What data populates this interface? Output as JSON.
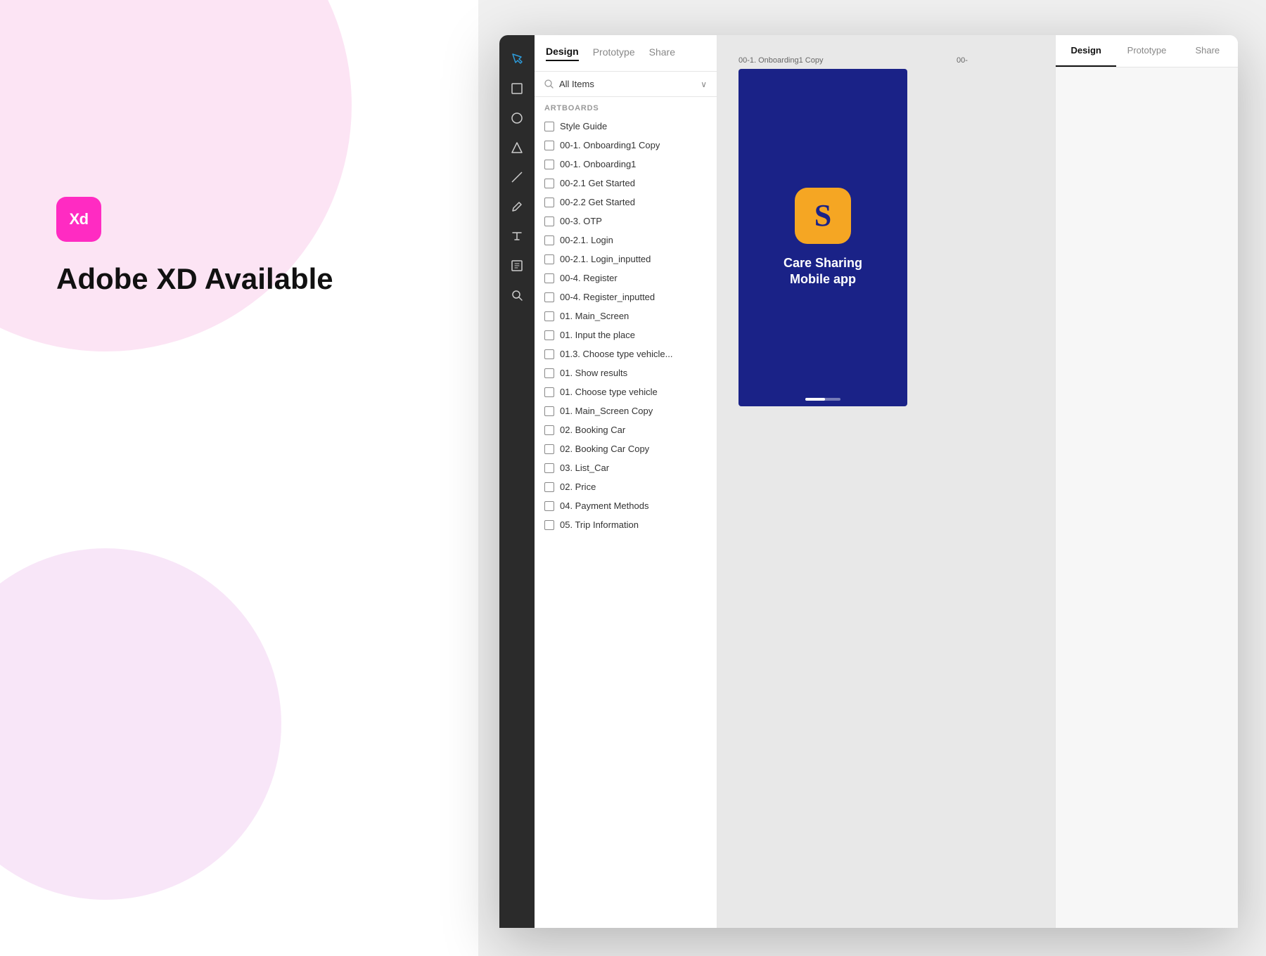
{
  "left": {
    "logo_text": "Xd",
    "title": "Adobe XD Available"
  },
  "xd_app": {
    "tabs": [
      {
        "id": "design",
        "label": "Design",
        "active": true
      },
      {
        "id": "prototype",
        "label": "Prototype",
        "active": false
      },
      {
        "id": "share",
        "label": "Share",
        "active": false
      }
    ],
    "search": {
      "placeholder": "All Items",
      "value": "All Items"
    },
    "section_label": "ARTBOARDS",
    "layers": [
      {
        "id": 1,
        "label": "Style Guide"
      },
      {
        "id": 2,
        "label": "00-1. Onboarding1 Copy"
      },
      {
        "id": 3,
        "label": "00-1. Onboarding1"
      },
      {
        "id": 4,
        "label": "00-2.1 Get Started"
      },
      {
        "id": 5,
        "label": "00-2.2 Get Started"
      },
      {
        "id": 6,
        "label": "00-3. OTP"
      },
      {
        "id": 7,
        "label": "00-2.1. Login"
      },
      {
        "id": 8,
        "label": "00-2.1. Login_inputted"
      },
      {
        "id": 9,
        "label": "00-4. Register"
      },
      {
        "id": 10,
        "label": "00-4. Register_inputted"
      },
      {
        "id": 11,
        "label": "01. Main_Screen"
      },
      {
        "id": 12,
        "label": "01. Input the place"
      },
      {
        "id": 13,
        "label": "01.3. Choose type vehicle..."
      },
      {
        "id": 14,
        "label": "01.  Show results"
      },
      {
        "id": 15,
        "label": "01. Choose type vehicle"
      },
      {
        "id": 16,
        "label": "01. Main_Screen Copy"
      },
      {
        "id": 17,
        "label": "02. Booking Car"
      },
      {
        "id": 18,
        "label": "02. Booking Car Copy"
      },
      {
        "id": 19,
        "label": "03. List_Car"
      },
      {
        "id": 20,
        "label": "02. Price"
      },
      {
        "id": 21,
        "label": "04. Payment Methods"
      },
      {
        "id": 22,
        "label": "05. Trip Information"
      }
    ],
    "artboard_title": "00-1. Onboarding1 Copy",
    "artboard_title_2": "00-",
    "app_icon_letter": "S",
    "app_name_line1": "Care Sharing",
    "app_name_line2": "Mobile app"
  },
  "icons": {
    "cursor": "▶",
    "rect": "□",
    "circle": "○",
    "triangle": "△",
    "line": "/",
    "pen": "✒",
    "text": "T",
    "component": "⊡",
    "zoom": "⌕",
    "search": "⌕",
    "chevron_down": "∨",
    "doc": "□"
  }
}
